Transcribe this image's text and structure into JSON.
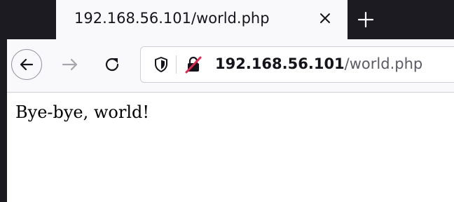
{
  "tab": {
    "title": "192.168.56.101/world.php",
    "close_icon": "close-icon"
  },
  "new_tab_icon": "plus-icon",
  "toolbar": {
    "back_icon": "back-arrow-icon",
    "forward_icon": "forward-arrow-icon",
    "reload_icon": "reload-icon"
  },
  "urlbar": {
    "tracking_icon": "shield-icon",
    "security_icon": "insecure-lock-icon",
    "host": "192.168.56.101",
    "path": "/world.php"
  },
  "page": {
    "text": "Bye-bye, world!"
  },
  "colors": {
    "chrome_dark": "#1c1b22",
    "chrome_light": "#f9f9fb",
    "insecure_red": "#e22850",
    "page_bg": "#ffffff"
  }
}
